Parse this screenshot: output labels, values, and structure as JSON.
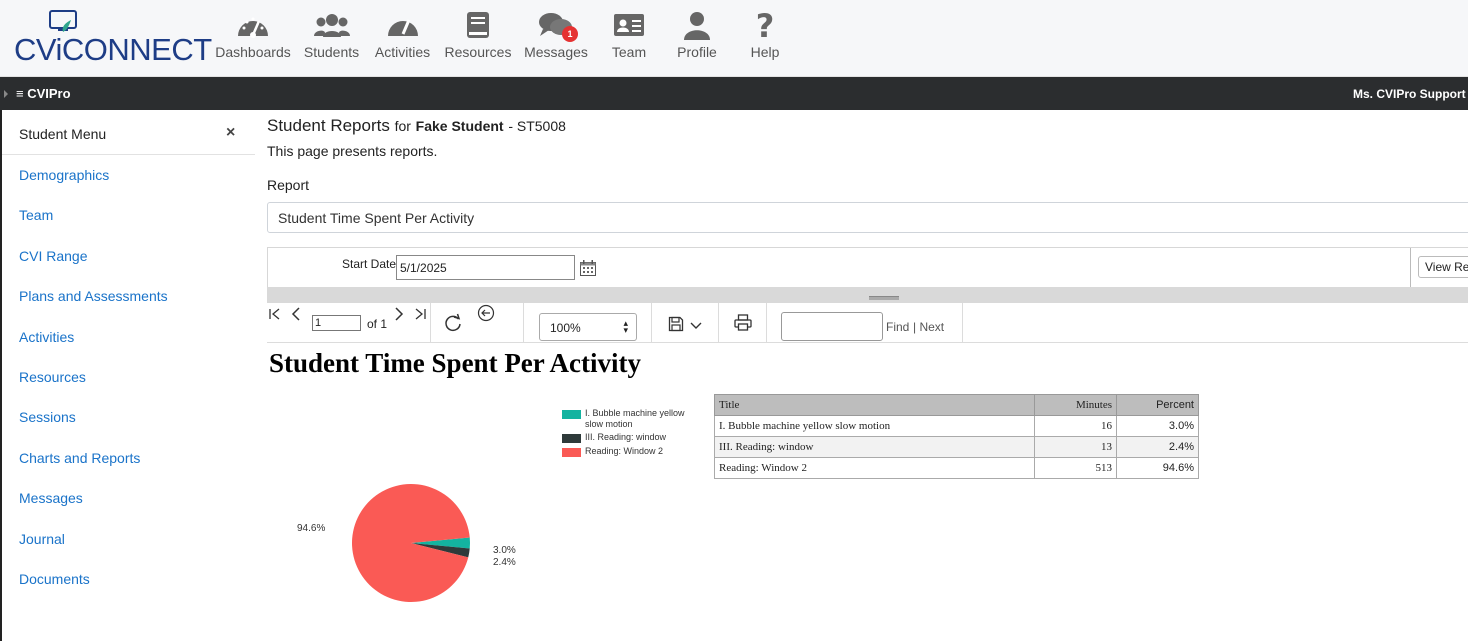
{
  "brand": {
    "logo_text": "CViCONNECT"
  },
  "nav": [
    {
      "label": "Dashboards",
      "icon": "dashboard-icon"
    },
    {
      "label": "Students",
      "icon": "students-icon"
    },
    {
      "label": "Activities",
      "icon": "activities-icon"
    },
    {
      "label": "Resources",
      "icon": "resources-icon"
    },
    {
      "label": "Messages",
      "icon": "messages-icon",
      "badge": "1"
    },
    {
      "label": "Team",
      "icon": "team-icon"
    },
    {
      "label": "Profile",
      "icon": "profile-icon"
    },
    {
      "label": "Help",
      "icon": "help-icon"
    }
  ],
  "darkbar": {
    "menu": "≡ CVIPro",
    "user": "Ms. CVIPro Support a"
  },
  "sidebar": {
    "title": "Student Menu",
    "close": "×",
    "items": [
      {
        "label": "Demographics"
      },
      {
        "label": "Team"
      },
      {
        "label": "CVI Range"
      },
      {
        "label": "Plans and Assessments"
      },
      {
        "label": "Activities"
      },
      {
        "label": "Resources"
      },
      {
        "label": "Sessions"
      },
      {
        "label": "Charts and Reports"
      },
      {
        "label": "Messages"
      },
      {
        "label": "Journal"
      },
      {
        "label": "Documents"
      }
    ]
  },
  "main": {
    "title": "Student Reports",
    "for": "for",
    "student_name": "Fake Student",
    "student_id": "- ST5008",
    "description": "This page presents reports.",
    "report_label": "Report",
    "report_value": "Student Time Spent Per Activity"
  },
  "params": {
    "start_label": "Start Date",
    "start_value": "5/1/2025",
    "view_button": "View Rep"
  },
  "toolbar": {
    "page_value": "1",
    "of_label": "of 1",
    "zoom": "100%",
    "find_label": "Find",
    "next_label": "| Next"
  },
  "report": {
    "title": "Student Time Spent Per Activity",
    "table": {
      "headers": [
        "Title",
        "Minutes",
        "Percent"
      ],
      "rows": [
        [
          "I. Bubble machine yellow slow motion",
          "16",
          "3.0%"
        ],
        [
          "III. Reading: window",
          "13",
          "2.4%"
        ],
        [
          "Reading: Window 2",
          "513",
          "94.6%"
        ]
      ]
    }
  },
  "chart_data": {
    "type": "pie",
    "categories": [
      "I. Bubble machine yellow slow motion",
      "III. Reading: window",
      "Reading: Window 2"
    ],
    "values": [
      3.0,
      2.4,
      94.6
    ],
    "labels": [
      "3.0%",
      "2.4%",
      "94.6%"
    ],
    "colors": [
      "#14b3a0",
      "#2e3a3a",
      "#fa5a55"
    ],
    "legend": "top-right"
  }
}
